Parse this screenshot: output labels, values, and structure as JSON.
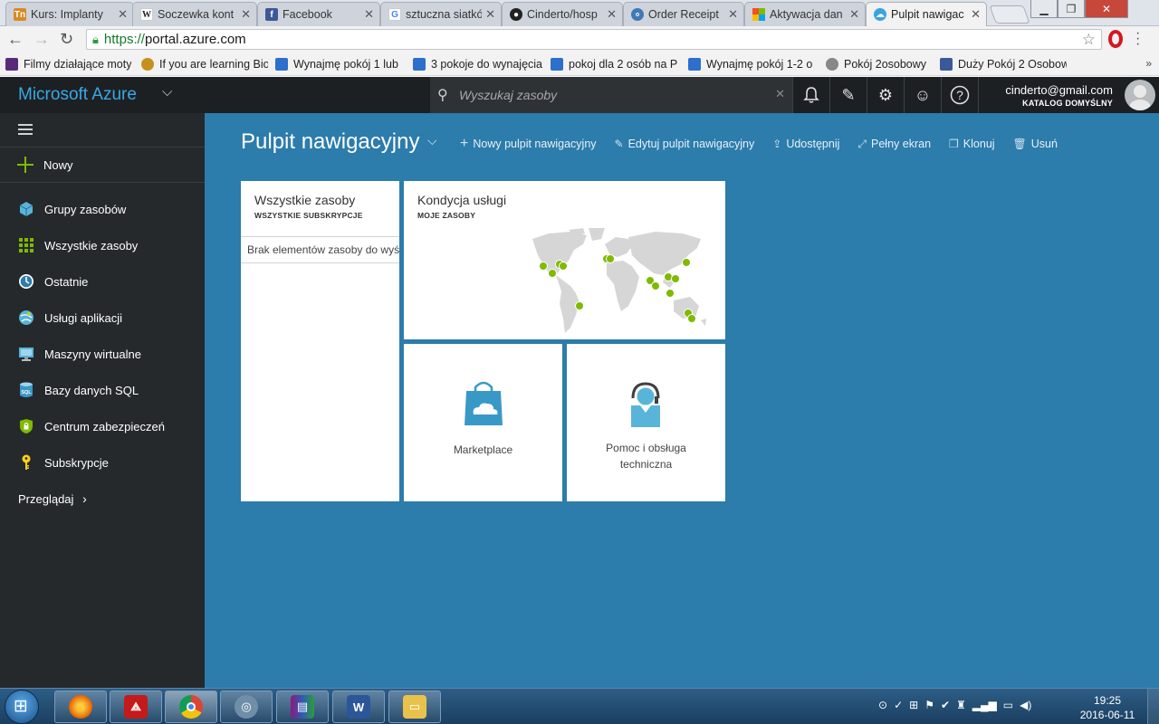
{
  "browser": {
    "tabs": [
      {
        "title": "Kurs: Implanty",
        "fav_color": "#d98a22",
        "fav_glyph": "Tn"
      },
      {
        "title": "Soczewka kont",
        "fav_color": "#ffffff",
        "fav_glyph": "W"
      },
      {
        "title": "Facebook",
        "fav_color": "#3b5998",
        "fav_glyph": "f"
      },
      {
        "title": "sztuczna siatkó",
        "fav_color": "#ffffff",
        "fav_glyph": "G"
      },
      {
        "title": "Cinderto/hosp",
        "fav_color": "#222222",
        "fav_glyph": "●"
      },
      {
        "title": "Order Receipt",
        "fav_color": "#3e7ab5",
        "fav_glyph": "o"
      },
      {
        "title": "Aktywacja dan",
        "fav_color": "#f25022",
        "fav_glyph": "▦"
      },
      {
        "title": "Pulpit nawigac",
        "fav_color": "#3ba3e0",
        "fav_glyph": "☁"
      }
    ],
    "url_scheme": "https://",
    "url_host": "portal.azure.com",
    "bookmarks": [
      {
        "label": "Filmy działające moty",
        "color": "#5a2a7a"
      },
      {
        "label": "If you are learning Bio",
        "color": "#c6901f"
      },
      {
        "label": "Wynajmę pokój 1 lub",
        "color": "#2c6fcc"
      },
      {
        "label": "3 pokoje do wynajęcia",
        "color": "#2c6fcc"
      },
      {
        "label": "pokoj dla 2 osób na P",
        "color": "#2c6fcc"
      },
      {
        "label": "Wynajmę pokój 1-2 o",
        "color": "#2c6fcc"
      },
      {
        "label": "Pokój 2osobowy",
        "color": "#888888"
      },
      {
        "label": "Duży Pokój 2 Osobow",
        "color": "#3b5998"
      }
    ],
    "bookmarks_more": "»"
  },
  "azure": {
    "brand": "Microsoft Azure",
    "search_placeholder": "Wyszukaj zasoby",
    "account_email": "cinderto@gmail.com",
    "account_directory": "KATALOG DOMYŚLNY",
    "sidebar": {
      "new_label": "Nowy",
      "items": [
        {
          "label": "Grupy zasobów",
          "icon": "resource-groups-icon"
        },
        {
          "label": "Wszystkie zasoby",
          "icon": "all-resources-icon"
        },
        {
          "label": "Ostatnie",
          "icon": "recent-icon"
        },
        {
          "label": "Usługi aplikacji",
          "icon": "app-services-icon"
        },
        {
          "label": "Maszyny wirtualne",
          "icon": "virtual-machines-icon"
        },
        {
          "label": "Bazy danych SQL",
          "icon": "sql-databases-icon"
        },
        {
          "label": "Centrum zabezpieczeń",
          "icon": "security-center-icon"
        },
        {
          "label": "Subskrypcje",
          "icon": "subscriptions-icon"
        }
      ],
      "browse_label": "Przeglądaj",
      "sql_badge": "SQL"
    },
    "dashboard": {
      "title": "Pulpit nawigacyjny",
      "commands": [
        {
          "label": "Nowy pulpit nawigacyjny",
          "icon": "plus-icon"
        },
        {
          "label": "Edytuj pulpit nawigacyjny",
          "icon": "pencil-icon"
        },
        {
          "label": "Udostępnij",
          "icon": "share-icon"
        },
        {
          "label": "Pełny ekran",
          "icon": "fullscreen-icon"
        },
        {
          "label": "Klonuj",
          "icon": "clone-icon"
        },
        {
          "label": "Usuń",
          "icon": "trash-icon"
        }
      ],
      "tiles": {
        "all_resources": {
          "title": "Wszystkie zasoby",
          "subtitle": "WSZYSTKIE SUBSKRYPCJE",
          "empty": "Brak elementów zasoby do wyświetlenia"
        },
        "service_health": {
          "title": "Kondycja usługi",
          "subtitle": "MOJE ZASOBY"
        },
        "marketplace": {
          "title": "Marketplace"
        },
        "help": {
          "title": "Pomoc i obsługa techniczna"
        }
      }
    }
  },
  "taskbar": {
    "time": "19:25",
    "date": "2016-06-11",
    "apps": [
      "firefox-icon",
      "acrobat-icon",
      "chrome-icon",
      "teamviewer-icon",
      "winrar-icon",
      "word-icon",
      "explorer-icon"
    ]
  }
}
